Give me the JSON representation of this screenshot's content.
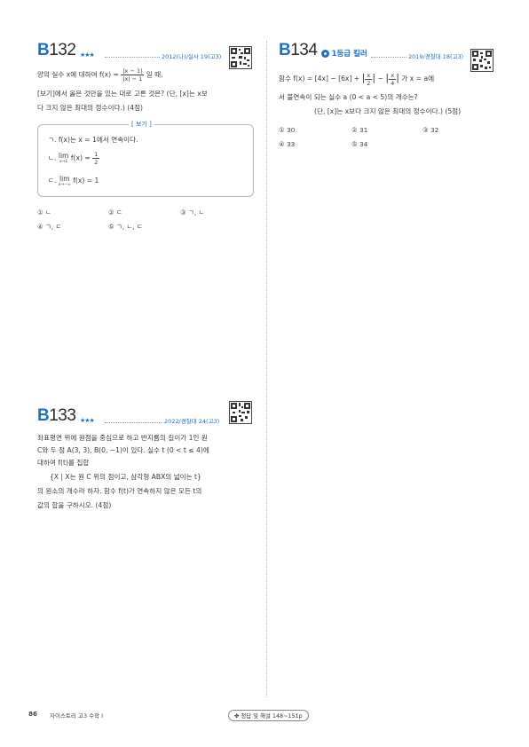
{
  "problems": {
    "b132": {
      "id_letter": "B",
      "id_number": "132",
      "stars": "★★★",
      "source": "2012(나)/실사 19(고3)",
      "line1_pre": "양의 실수 x에 대하여 f(x) =",
      "frac_num": "|x − 1|",
      "frac_den": "|x| − 1",
      "line1_post": "일 때,",
      "line2": "[보기]에서 옳은 것만을 있는 대로 고른 것은? (단, [x]는 x보",
      "line3": "다 크지 않은 최대의 정수이다.) (4점)",
      "bogi_label": "보기",
      "bogi_1": "ㄱ. f(x)는 x = 1에서 연속이다.",
      "bogi_2_pre": "ㄴ.",
      "bogi_2_lim": "lim",
      "bogi_2_sub": "x→1",
      "bogi_2_post": "f(x) =",
      "bogi_2_num": "1",
      "bogi_2_den": "2",
      "bogi_3_pre": "ㄷ.",
      "bogi_3_lim": "lim",
      "bogi_3_sub": "x→−∞",
      "bogi_3_post": "f(x) = 1",
      "choices": [
        "① ㄴ",
        "② ㄷ",
        "③ ㄱ, ㄴ",
        "④ ㄱ, ㄷ",
        "⑤ ㄱ, ㄴ, ㄷ"
      ]
    },
    "b133": {
      "id_letter": "B",
      "id_number": "133",
      "stars": "★★★",
      "source": "2022/경찰대 24(고3)",
      "lines": [
        "좌표평면 위에 원점을 중심으로 하고 반지름의 길이가 1인 원",
        "C와 두 점 A(3, 3), B(0, −1)이 있다. 실수 t (0 < t ≤ 4)에",
        "대하여 f(t)를 집합",
        "{X | X는 원 C 위의 점이고, 삼각형 ABX의 넓이는 t}",
        "의 원소의 개수라 하자. 함수 f(t)가 연속하지 않은 모든 t의",
        "값의 합을 구하시오. (4점)"
      ]
    },
    "b134": {
      "id_letter": "B",
      "id_number": "134",
      "badge": "1등급 킬러",
      "source": "2019/경찰대 18(고3)",
      "line1_pre": "함수 f(x) = [4x] − [6x] +",
      "line1_mid": "−",
      "line1_post": "가 x = a에",
      "frac1_num": "x",
      "frac1_den": "2",
      "frac2_num": "x",
      "frac2_den": "4",
      "line2": "서 불연속이 되는 실수 a (0 < a < 5)의 개수는?",
      "line3": "(단, [x]는 x보다 크지 않은 최대의 정수이다.) (5점)",
      "choices": [
        "① 30",
        "② 31",
        "③ 32",
        "④ 33",
        "⑤ 34"
      ]
    }
  },
  "footer": {
    "page_number": "86",
    "book_title": "자이스토리 고3 수학 I",
    "answer_ref": "✤ 정답 및 해설 148~151p"
  },
  "colors": {
    "accent": "#1e6fc6",
    "text": "#333333",
    "border": "#b8b8b8"
  }
}
